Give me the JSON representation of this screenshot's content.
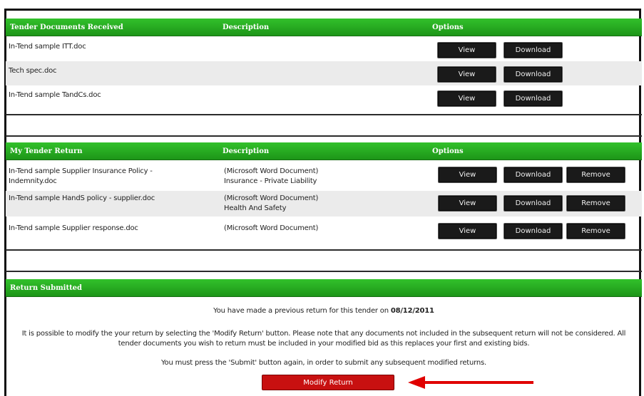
{
  "received": {
    "headers": [
      "Tender Documents Received",
      "Description",
      "Options"
    ],
    "rows": [
      {
        "name": "In-Tend sample ITT.doc",
        "description": ""
      },
      {
        "name": "Tech spec.doc",
        "description": ""
      },
      {
        "name": "In-Tend sample TandCs.doc",
        "description": ""
      }
    ],
    "view_label": "View",
    "download_label": "Download"
  },
  "my_return": {
    "headers": [
      "My Tender Return",
      "Description",
      "Options"
    ],
    "rows": [
      {
        "name_line1": "In-Tend sample Supplier Insurance Policy -",
        "name_line2": "Indemnity.doc",
        "desc_line1": "(Microsoft Word Document)",
        "desc_line2": "Insurance - Private Liability"
      },
      {
        "name_line1": "In-Tend sample HandS policy - supplier.doc",
        "name_line2": "",
        "desc_line1": "(Microsoft Word Document)",
        "desc_line2": "Health And Safety"
      },
      {
        "name_line1": "In-Tend sample Supplier response.doc",
        "name_line2": "",
        "desc_line1": "(Microsoft Word Document)",
        "desc_line2": ""
      }
    ],
    "view_label": "View",
    "download_label": "Download",
    "remove_label": "Remove"
  },
  "submitted": {
    "header": "Return Submitted",
    "line1_prefix": "You have made a previous return for this tender on",
    "line1_date": "08/12/2011",
    "line2a": "It is possible to modify the your return by selecting the 'Modify Return' button. Please note that any documents not included in the subsequent return will not be considered. All",
    "line2b": "tender documents you wish to return must be included in your modified bid as this replaces your first and existing bids.",
    "line3": "You must press the 'Submit' button again, in order to submit any subsequent modified returns.",
    "modify_label": "Modify Return"
  },
  "colors": {
    "header_green": "#22a81d",
    "button_dark": "#1a1a1a",
    "modify_red": "#c81010",
    "arrow_red": "#e00000"
  }
}
